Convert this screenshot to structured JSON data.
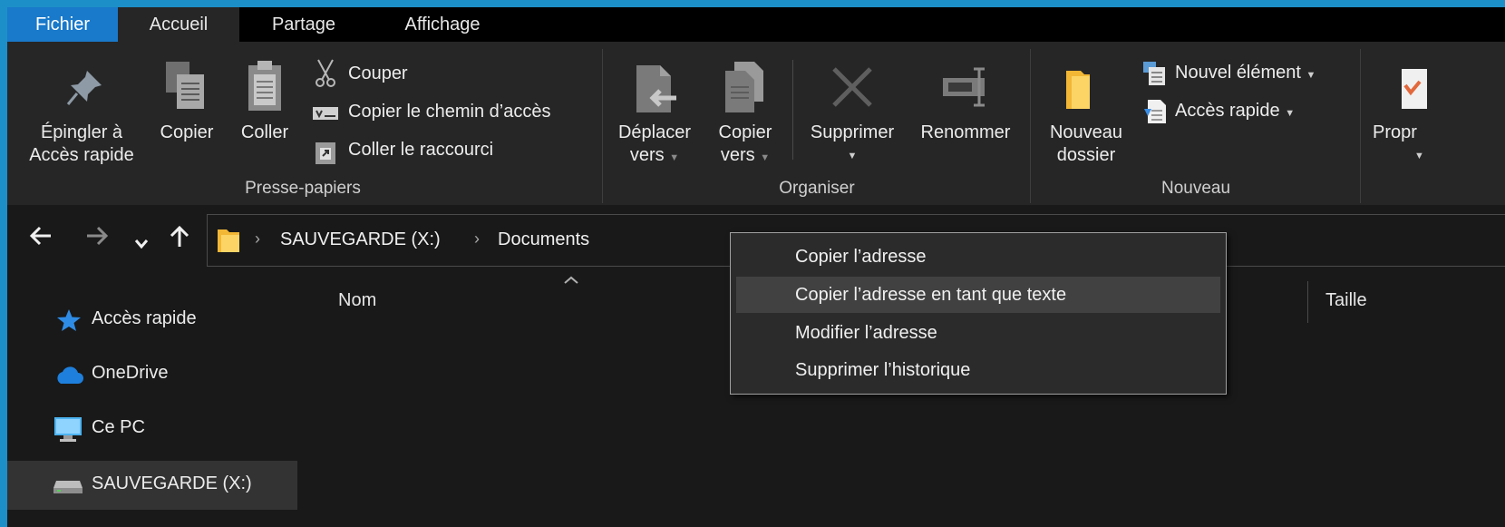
{
  "tabs": {
    "file": "Fichier",
    "home": "Accueil",
    "share": "Partage",
    "view": "Affichage"
  },
  "ribbon": {
    "clipboard": {
      "pin_line1": "Épingler à",
      "pin_line2": "Accès rapide",
      "copy": "Copier",
      "paste": "Coller",
      "cut": "Couper",
      "copy_path": "Copier le chemin d’accès",
      "paste_shortcut": "Coller le raccourci",
      "group": "Presse-papiers"
    },
    "organize": {
      "move_line1": "Déplacer",
      "move_line2": "vers",
      "copyto_line1": "Copier",
      "copyto_line2": "vers",
      "delete": "Supprimer",
      "rename": "Renommer",
      "group": "Organiser"
    },
    "new": {
      "folder_line1": "Nouveau",
      "folder_line2": "dossier",
      "new_item": "Nouvel élément",
      "easy_access": "Accès rapide",
      "group": "Nouveau"
    },
    "open": {
      "properties": "Propr"
    }
  },
  "address": {
    "drive": "SAUVEGARDE (X:)",
    "folder": "Documents"
  },
  "nav": {
    "quick_access": "Accès rapide",
    "onedrive": "OneDrive",
    "this_pc": "Ce PC",
    "drive": "SAUVEGARDE (X:)"
  },
  "columns": {
    "name": "Nom",
    "size": "Taille"
  },
  "context_menu": {
    "items": [
      "Copier l’adresse",
      "Copier l’adresse en tant que texte",
      "Modifier l’adresse",
      "Supprimer l’historique"
    ]
  },
  "colors": {
    "accent": "#1979ca",
    "background": "#191919",
    "ribbon": "#262626",
    "folder": "#f5c542"
  }
}
